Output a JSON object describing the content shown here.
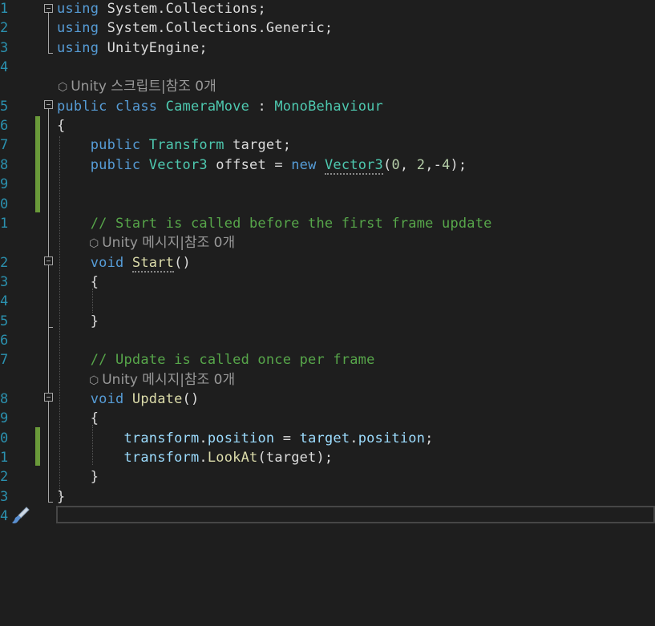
{
  "editor": {
    "lines": [
      {
        "num": "1",
        "tokens": [
          {
            "t": "using",
            "c": "kw"
          },
          {
            "t": " System",
            "c": "df"
          },
          {
            "t": ".",
            "c": "df"
          },
          {
            "t": "Collections",
            "c": "df"
          },
          {
            "t": ";",
            "c": "df"
          }
        ]
      },
      {
        "num": "2",
        "tokens": [
          {
            "t": "using",
            "c": "kw"
          },
          {
            "t": " System.Collections.Generic;",
            "c": "df"
          }
        ]
      },
      {
        "num": "3",
        "tokens": [
          {
            "t": "using",
            "c": "kw"
          },
          {
            "t": " UnityEngine;",
            "c": "df"
          }
        ]
      },
      {
        "num": "4",
        "tokens": []
      },
      {
        "num": "",
        "codelens": "Unity 스크립트|참조 0개"
      },
      {
        "num": "5",
        "tokens": [
          {
            "t": "public",
            "c": "kw"
          },
          {
            "t": " ",
            "c": "df"
          },
          {
            "t": "class",
            "c": "kw"
          },
          {
            "t": " ",
            "c": "df"
          },
          {
            "t": "CameraMove",
            "c": "ty"
          },
          {
            "t": " : ",
            "c": "df"
          },
          {
            "t": "MonoBehaviour",
            "c": "ty"
          }
        ]
      },
      {
        "num": "6",
        "tokens": [
          {
            "t": "{",
            "c": "df"
          }
        ]
      },
      {
        "num": "7",
        "tokens": [
          {
            "t": "    public",
            "c": "kw"
          },
          {
            "t": " ",
            "c": "df"
          },
          {
            "t": "Transform",
            "c": "ty"
          },
          {
            "t": " target;",
            "c": "df"
          }
        ]
      },
      {
        "num": "8",
        "tokens": [
          {
            "t": "    public",
            "c": "kw"
          },
          {
            "t": " ",
            "c": "df"
          },
          {
            "t": "Vector3",
            "c": "ty"
          },
          {
            "t": " offset = ",
            "c": "df"
          },
          {
            "t": "new",
            "c": "kw"
          },
          {
            "t": " ",
            "c": "df"
          },
          {
            "t": "Vector3",
            "c": "ty",
            "u": true
          },
          {
            "t": "(",
            "c": "df"
          },
          {
            "t": "0",
            "c": "nm"
          },
          {
            "t": ", ",
            "c": "df"
          },
          {
            "t": "2",
            "c": "nm"
          },
          {
            "t": ",-",
            "c": "df"
          },
          {
            "t": "4",
            "c": "nm"
          },
          {
            "t": ");",
            "c": "df"
          }
        ]
      },
      {
        "num": "9",
        "tokens": []
      },
      {
        "num": "0",
        "tokens": []
      },
      {
        "num": "1",
        "tokens": [
          {
            "t": "    // Start is called before the first frame update",
            "c": "cm"
          }
        ]
      },
      {
        "num": "",
        "codelens": "Unity 메시지|참조 0개",
        "indent": true
      },
      {
        "num": "2",
        "tokens": [
          {
            "t": "    void",
            "c": "kw"
          },
          {
            "t": " ",
            "c": "df"
          },
          {
            "t": "Start",
            "c": "fn",
            "u": true
          },
          {
            "t": "()",
            "c": "df"
          }
        ]
      },
      {
        "num": "3",
        "tokens": [
          {
            "t": "    {",
            "c": "df"
          }
        ]
      },
      {
        "num": "4",
        "tokens": []
      },
      {
        "num": "5",
        "tokens": [
          {
            "t": "    }",
            "c": "df"
          }
        ]
      },
      {
        "num": "6",
        "tokens": []
      },
      {
        "num": "7",
        "tokens": [
          {
            "t": "    // Update is called once per frame",
            "c": "cm"
          }
        ]
      },
      {
        "num": "",
        "codelens": "Unity 메시지|참조 0개",
        "indent": true
      },
      {
        "num": "8",
        "tokens": [
          {
            "t": "    void",
            "c": "kw"
          },
          {
            "t": " ",
            "c": "df"
          },
          {
            "t": "Update",
            "c": "fn"
          },
          {
            "t": "()",
            "c": "df"
          }
        ]
      },
      {
        "num": "9",
        "tokens": [
          {
            "t": "    {",
            "c": "df"
          }
        ]
      },
      {
        "num": "0",
        "tokens": [
          {
            "t": "        transform",
            "c": "pm"
          },
          {
            "t": ".",
            "c": "df"
          },
          {
            "t": "position",
            "c": "pm"
          },
          {
            "t": " = ",
            "c": "df"
          },
          {
            "t": "target",
            "c": "pm"
          },
          {
            "t": ".",
            "c": "df"
          },
          {
            "t": "position",
            "c": "pm"
          },
          {
            "t": ";",
            "c": "df"
          }
        ]
      },
      {
        "num": "1",
        "tokens": [
          {
            "t": "        transform",
            "c": "pm"
          },
          {
            "t": ".",
            "c": "df"
          },
          {
            "t": "LookAt",
            "c": "fn"
          },
          {
            "t": "(target);",
            "c": "df"
          }
        ]
      },
      {
        "num": "2",
        "tokens": [
          {
            "t": "    }",
            "c": "df"
          }
        ]
      },
      {
        "num": "3",
        "tokens": [
          {
            "t": "}",
            "c": "df"
          }
        ]
      },
      {
        "num": "4",
        "tokens": []
      }
    ]
  }
}
